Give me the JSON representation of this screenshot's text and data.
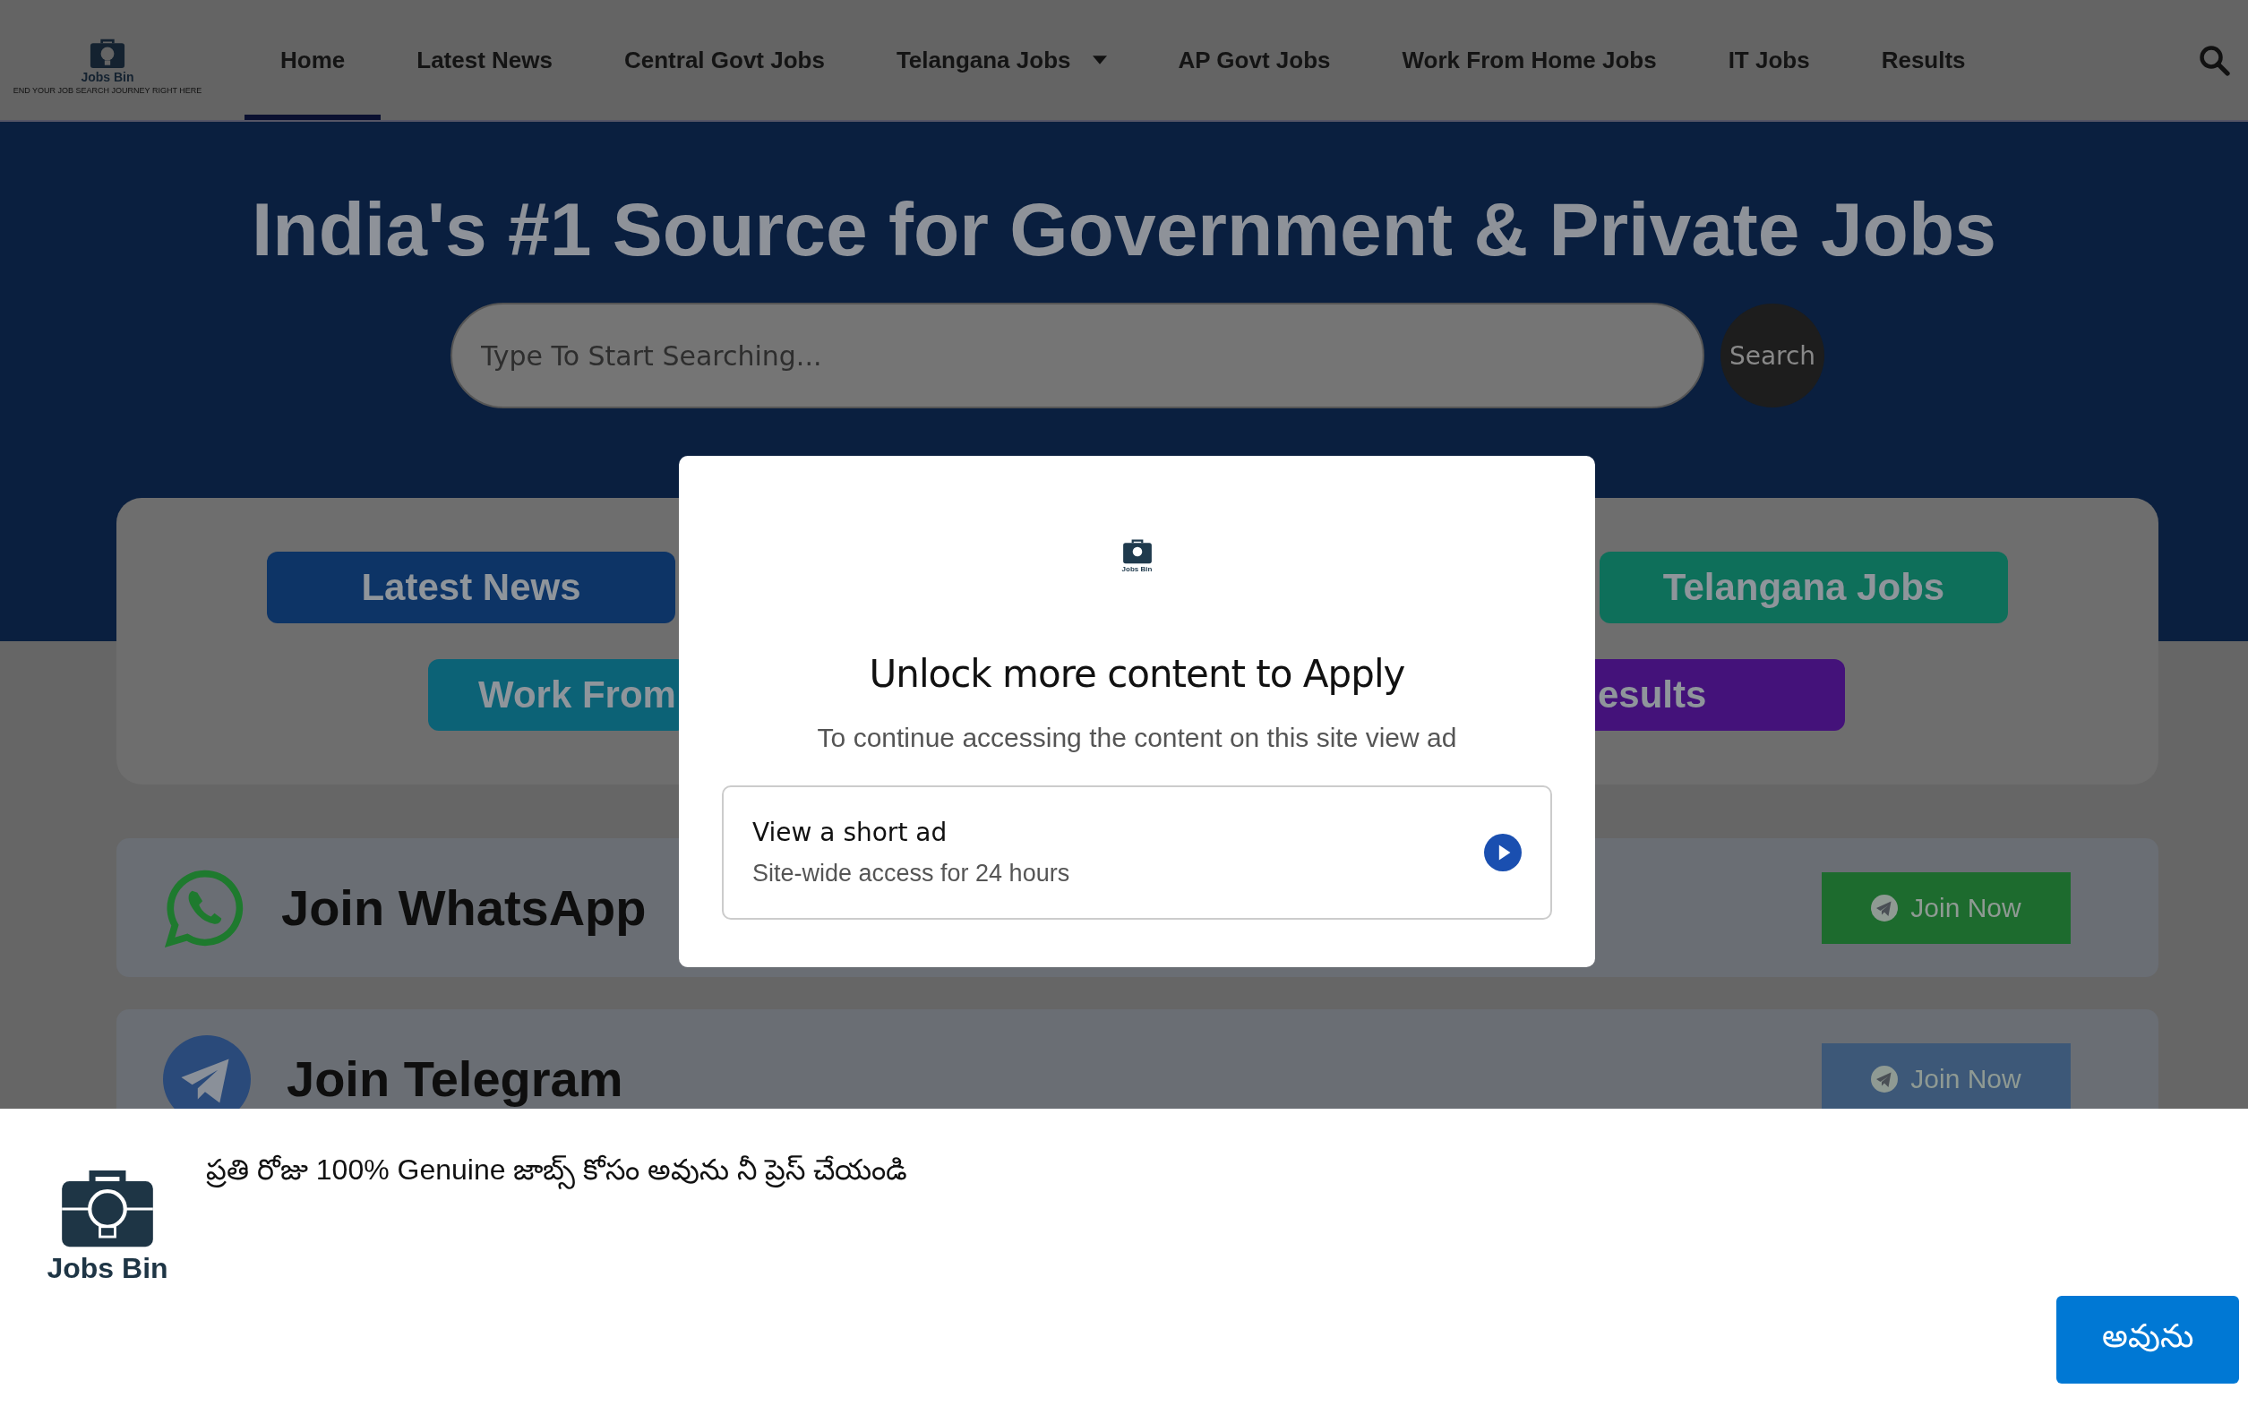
{
  "header": {
    "logo": {
      "name": "Jobs Bin",
      "tagline": "END YOUR JOB SEARCH JOURNEY RIGHT HERE"
    },
    "nav": [
      {
        "label": "Home",
        "selected": true,
        "dropdown": false
      },
      {
        "label": "Latest News",
        "selected": false,
        "dropdown": false
      },
      {
        "label": "Central Govt Jobs",
        "selected": false,
        "dropdown": false
      },
      {
        "label": "Telangana Jobs",
        "selected": false,
        "dropdown": true
      },
      {
        "label": "AP Govt Jobs",
        "selected": false,
        "dropdown": false
      },
      {
        "label": "Work From Home Jobs",
        "selected": false,
        "dropdown": false
      },
      {
        "label": "IT Jobs",
        "selected": false,
        "dropdown": false
      },
      {
        "label": "Results",
        "selected": false,
        "dropdown": false
      }
    ]
  },
  "hero": {
    "title": "India's #1 Source for Government & Private Jobs",
    "search": {
      "placeholder": "Type To Start Searching...",
      "button": "Search"
    }
  },
  "categories": [
    [
      {
        "label": "Latest News",
        "color": "#0d3466"
      },
      {
        "label": "Telangana Jobs",
        "color": "#0e6f5a"
      }
    ],
    [
      {
        "label": "Work From",
        "color": "#0c6276"
      },
      {
        "label": "esults",
        "color": "#44127a"
      }
    ]
  ],
  "community": [
    {
      "kind": "whatsapp",
      "label": "Join WhatsApp",
      "button": "Join Now"
    },
    {
      "kind": "telegram",
      "label": "Join Telegram",
      "button": "Join Now"
    }
  ],
  "modal": {
    "logo_name": "Jobs Bin",
    "title": "Unlock more content to Apply",
    "subtitle": "To continue accessing the content on this site view ad",
    "option": {
      "title": "View a short ad",
      "subtitle": "Site-wide access for 24 hours"
    }
  },
  "consent": {
    "logo_name": "Jobs Bin",
    "message": "ప్రతి రోజు 100% Genuine జాబ్స్ కోసం అవును నీ ప్రెస్ చేయండి",
    "button": "అవును"
  }
}
